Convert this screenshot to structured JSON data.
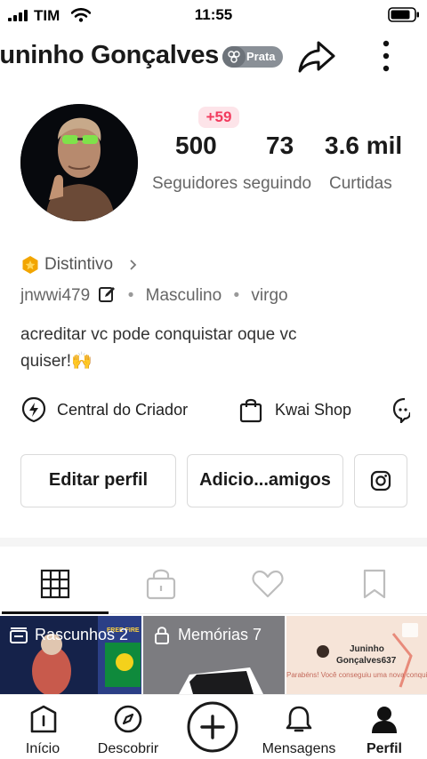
{
  "status_bar": {
    "carrier": "TIM",
    "time": "11:55"
  },
  "header": {
    "name": "Juninho Gonçalves",
    "badge": "Prata"
  },
  "profile": {
    "new_followers": "+59",
    "stats": [
      {
        "value": "500",
        "label": "Seguidores"
      },
      {
        "value": "73",
        "label": "seguindo"
      },
      {
        "value": "3.6 mil",
        "label": "Curtidas"
      }
    ],
    "distintivo": "Distintivo",
    "username": "jnwwi479",
    "gender": "Masculino",
    "sign": "virgo",
    "bio_line1": "acreditar vc pode conquistar oque vc",
    "bio_line2": "quiser!🙌"
  },
  "quick_links": {
    "creator": "Central do Criador",
    "shop": "Kwai Shop"
  },
  "buttons": {
    "edit": "Editar perfil",
    "add": "Adicio...amigos"
  },
  "thumbnails": {
    "drafts": "Rascunhos 2",
    "memories": "Memórias 7",
    "card_name_line1": "Juninho",
    "card_name_line2": "Gonçalves637",
    "card_caption": "Parabéns! Você conseguiu uma nova conquista"
  },
  "bottom_nav": {
    "home": "Início",
    "discover": "Descobrir",
    "messages": "Mensagens",
    "profile": "Perfil"
  },
  "colors": {
    "accent_red": "#f23b5e",
    "badge_gray": "#8a9097",
    "gold": "#f2a500"
  }
}
